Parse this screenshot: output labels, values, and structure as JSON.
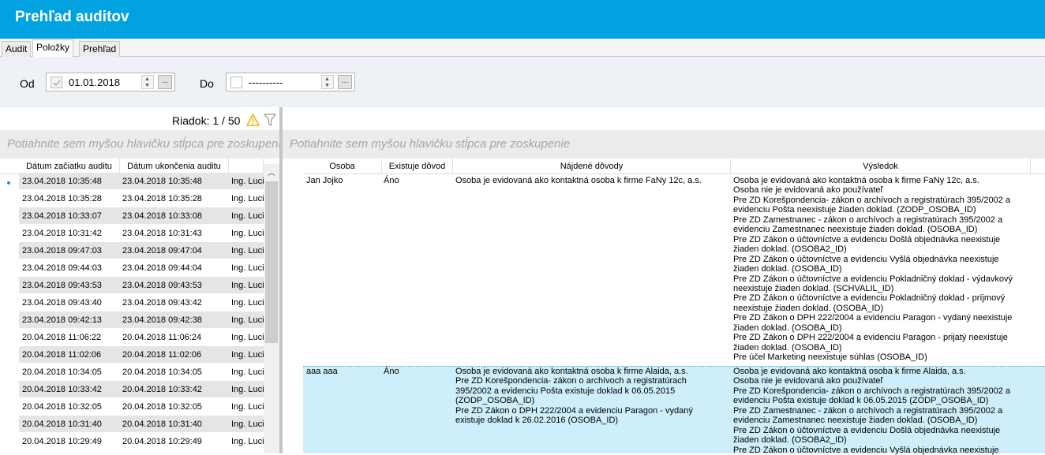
{
  "window": {
    "title": "Prehľad auditov"
  },
  "tabs": [
    "Audit",
    "Položky",
    "Prehľad"
  ],
  "filter": {
    "from_label": "Od",
    "from_value": "01.01.2018",
    "from_checked": true,
    "to_label": "Do",
    "to_value": "----------",
    "to_checked": false,
    "ellipsis": "..."
  },
  "status": {
    "row_counter": "Riadok: 1 / 50"
  },
  "left_grid": {
    "group_hint": "Potiahnite sem myšou hlavičku stĺpca pre zoskupenie",
    "columns": [
      "Dátum začiatku auditu",
      "Dátum ukončenia auditu",
      ""
    ],
    "rows": [
      [
        "23.04.2018 10:35:48",
        "23.04.2018 10:35:48",
        "Ing. Lucia"
      ],
      [
        "23.04.2018 10:35:28",
        "23.04.2018 10:35:28",
        "Ing. Lucia"
      ],
      [
        "23.04.2018 10:33:07",
        "23.04.2018 10:33:08",
        "Ing. Lucia"
      ],
      [
        "23.04.2018 10:31:42",
        "23.04.2018 10:31:43",
        "Ing. Lucia"
      ],
      [
        "23.04.2018 09:47:03",
        "23.04.2018 09:47:04",
        "Ing. Lucia"
      ],
      [
        "23.04.2018 09:44:03",
        "23.04.2018 09:44:04",
        "Ing. Lucia"
      ],
      [
        "23.04.2018 09:43:53",
        "23.04.2018 09:43:53",
        "Ing. Lucia"
      ],
      [
        "23.04.2018 09:43:40",
        "23.04.2018 09:43:42",
        "Ing. Lucia"
      ],
      [
        "23.04.2018 09:42:13",
        "23.04.2018 09:42:38",
        "Ing. Lucia"
      ],
      [
        "20.04.2018 11:06:22",
        "20.04.2018 11:06:24",
        "Ing. Lucia"
      ],
      [
        "20.04.2018 11:02:06",
        "20.04.2018 11:02:06",
        "Ing. Lucia"
      ],
      [
        "20.04.2018 10:34:05",
        "20.04.2018 10:34:05",
        "Ing. Lucia"
      ],
      [
        "20.04.2018 10:33:42",
        "20.04.2018 10:33:42",
        "Ing. Lucia"
      ],
      [
        "20.04.2018 10:32:05",
        "20.04.2018 10:32:05",
        "Ing. Lucia"
      ],
      [
        "20.04.2018 10:31:40",
        "20.04.2018 10:31:40",
        "Ing. Lucia"
      ],
      [
        "20.04.2018 10:29:49",
        "20.04.2018 10:29:49",
        "Ing. Lucia"
      ]
    ]
  },
  "right_grid": {
    "group_hint": "Potiahnite sem myšou hlavičku stĺpca pre zoskupenie",
    "columns": [
      "Osoba",
      "Existuje dôvod",
      "Nájdené dôvody",
      "Výsledok"
    ],
    "rows": [
      {
        "osoba": "Jan Jojko",
        "existuje": "Áno",
        "dovody": [
          "Osoba je evidovaná ako kontaktná osoba k firme FaNy 12c, a.s."
        ],
        "vysledok": [
          "Osoba je evidovaná ako kontaktná osoba k firme FaNy 12c, a.s.",
          "Osoba nie je evidovaná ako používateľ",
          "Pre ZD Korešpondencia- zákon o archívoch a registratúrach 395/2002 a",
          "evidenciu Pošta neexistuje žiaden doklad. (ZODP_OSOBA_ID)",
          "Pre ZD Zamestnanec - zákon o archívoch a registratúrach 395/2002 a",
          "evidenciu Zamestnanec neexistuje žiaden doklad. (OSOBA_ID)",
          "Pre ZD Zákon o účtovníctve a evidenciu Došlá objednávka neexistuje",
          "žiaden doklad. (OSOBA2_ID)",
          "Pre ZD Zákon o účtovníctve a evidenciu Vyšlá objednávka neexistuje",
          "žiaden doklad. (OSOBA_ID)",
          "Pre ZD Zákon o účtovníctve a evidenciu Pokladničný doklad - výdavkový",
          "neexistuje žiaden doklad. (SCHVALIL_ID)",
          "Pre ZD Zákon o účtovníctve a evidenciu Pokladničný doklad - príjmový",
          "neexistuje žiaden doklad. (OSOBA_ID)",
          "Pre ZD Zákon o DPH 222/2004 a evidenciu Paragon - vydaný neexistuje",
          "žiaden doklad. (OSOBA_ID)",
          "Pre ZD Zákon o DPH 222/2004 a evidenciu Paragon - prijatý neexistuje",
          "žiaden doklad. (OSOBA_ID)",
          "Pre účel Marketing neexistuje súhlas (OSOBA_ID)"
        ]
      },
      {
        "osoba": "aaa aaa",
        "existuje": "Áno",
        "dovody": [
          "Osoba je evidovaná ako kontaktná osoba k firme Alaida, a.s.",
          "Pre ZD Korešpondencia- zákon o archívoch a registratúrach",
          "395/2002 a evidenciu Pošta existuje doklad k 06.05.2015",
          "(ZODP_OSOBA_ID)",
          "Pre ZD Zákon o DPH 222/2004 a evidenciu Paragon - vydaný",
          "existuje doklad k 26.02.2016 (OSOBA_ID)"
        ],
        "vysledok": [
          "Osoba je evidovaná ako kontaktná osoba k firme Alaida, a.s.",
          "Osoba nie je evidovaná ako používateľ",
          "Pre ZD Korešpondencia- zákon o archívoch a registratúrach 395/2002 a",
          "evidenciu Pošta existuje doklad k 06.05.2015 (ZODP_OSOBA_ID)",
          "Pre ZD Zamestnanec - zákon o archívoch a registratúrach 395/2002 a",
          "evidenciu Zamestnanec neexistuje žiaden doklad. (OSOBA_ID)",
          "Pre ZD Zákon o účtovníctve a evidenciu Došlá objednávka neexistuje",
          "žiaden doklad. (OSOBA2_ID)",
          "Pre ZD Zákon o účtovníctve a evidenciu Vyšlá objednávka neexistuje"
        ]
      }
    ]
  },
  "colors": {
    "accent": "#00a2df",
    "selected_row": "#cdeefa",
    "alt_row": "#e5e5e5",
    "warning": "#f0b400"
  }
}
